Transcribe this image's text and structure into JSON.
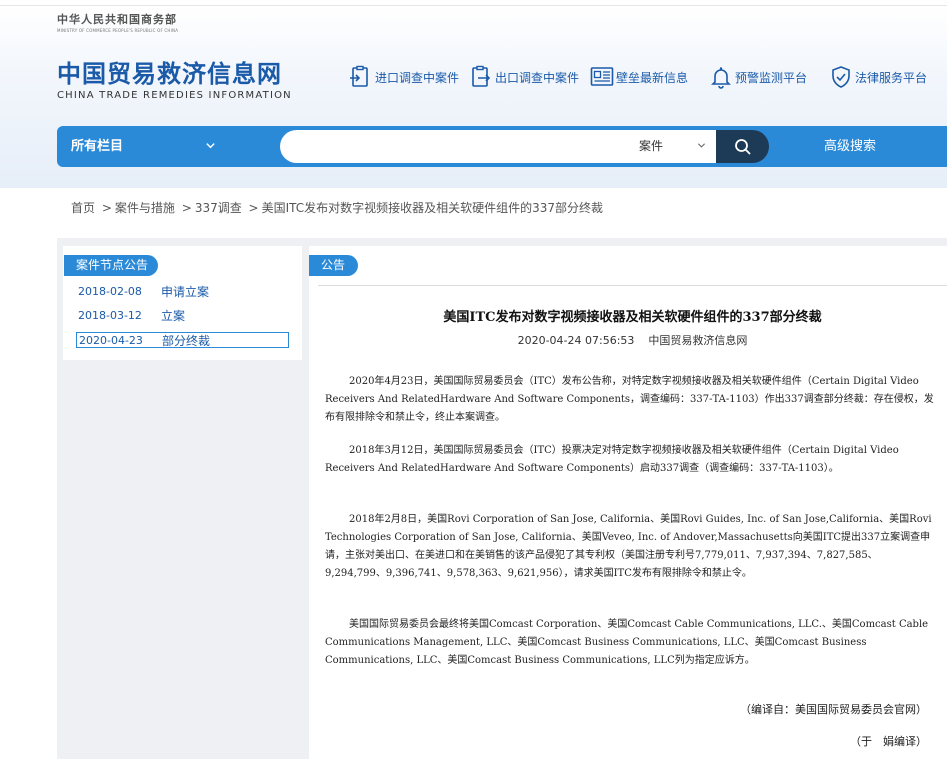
{
  "gov": {
    "title_cn": "中华人民共和国商务部",
    "title_en": "MINISTRY OF COMMERCE PEOPLE'S REPUBLIC OF CHINA"
  },
  "site": {
    "title_cn": "中国贸易救济信息网",
    "title_en": "CHINA TRADE REMEDIES INFORMATION"
  },
  "topnav": [
    {
      "label": "进口调查中案件",
      "icon": "import-case-icon"
    },
    {
      "label": "出口调查中案件",
      "icon": "export-case-icon"
    },
    {
      "label": "壁垒最新信息",
      "icon": "barrier-news-icon"
    },
    {
      "label": "预警监测平台",
      "icon": "bell-icon"
    },
    {
      "label": "法律服务平台",
      "icon": "shield-check-icon"
    }
  ],
  "search": {
    "category": "所有栏目",
    "input_value": "",
    "placeholder": "",
    "type": "案件",
    "advanced": "高级搜索"
  },
  "breadcrumb": [
    "首页",
    "案件与措施",
    "337调查",
    "美国ITC发布对数字视频接收器及相关软硬件组件的337部分终裁"
  ],
  "sidebar": {
    "tag": "案件节点公告",
    "items": [
      {
        "date": "2018-02-08",
        "label": "申请立案"
      },
      {
        "date": "2018-03-12",
        "label": "立案"
      },
      {
        "date": "2020-04-23",
        "label": "部分终裁"
      }
    ]
  },
  "article": {
    "tag": "公告",
    "title": "美国ITC发布对数字视频接收器及相关软硬件组件的337部分终裁",
    "datetime": "2020-04-24 07:56:53",
    "source": "中国贸易救济信息网",
    "paragraphs": [
      "2020年4月23日，美国国际贸易委员会（ITC）发布公告称，对特定数字视频接收器及相关软硬件组件（Certain Digital Video Receivers And RelatedHardware And Software Components，调查编码：337-TA-1103）作出337调查部分终裁：存在侵权，发布有限排除令和禁止令，终止本案调查。",
      "2018年3月12日，美国国际贸易委员会（ITC）投票决定对特定数字视频接收器及相关软硬件组件（Certain Digital Video Receivers And RelatedHardware And Software Components）启动337调查（调查编码：337-TA-1103）。",
      "2018年2月8日，美国Rovi Corporation of San Jose, California、美国Rovi Guides, Inc. of San Jose,California、美国Rovi Technologies Corporation of San Jose, California、美国Veveo, Inc. of Andover,Massachusetts向美国ITC提出337立案调查申请，主张对美出口、在美进口和在美销售的该产品侵犯了其专利权（美国注册专利号7,779,011、7,937,394、7,827,585、9,294,799、9,396,741、9,578,363、9,621,956），请求美国ITC发布有限排除令和禁止令。",
      "美国国际贸易委员会最终将美国Comcast Corporation、美国Comcast Cable Communications, LLC.、美国Comcast Cable Communications Management, LLC、美国Comcast Business Communications, LLC、美国Comcast Business Communications, LLC、美国Comcast Business Communications, LLC列为指定应诉方。"
    ],
    "compiled_from": "（编译自：美国国际贸易委员会官网）",
    "editor": "（于　娟编译）"
  },
  "colors": {
    "brand_blue": "#2b8ad8",
    "title_blue": "#1a5aa8",
    "search_btn": "#1d3a56"
  }
}
